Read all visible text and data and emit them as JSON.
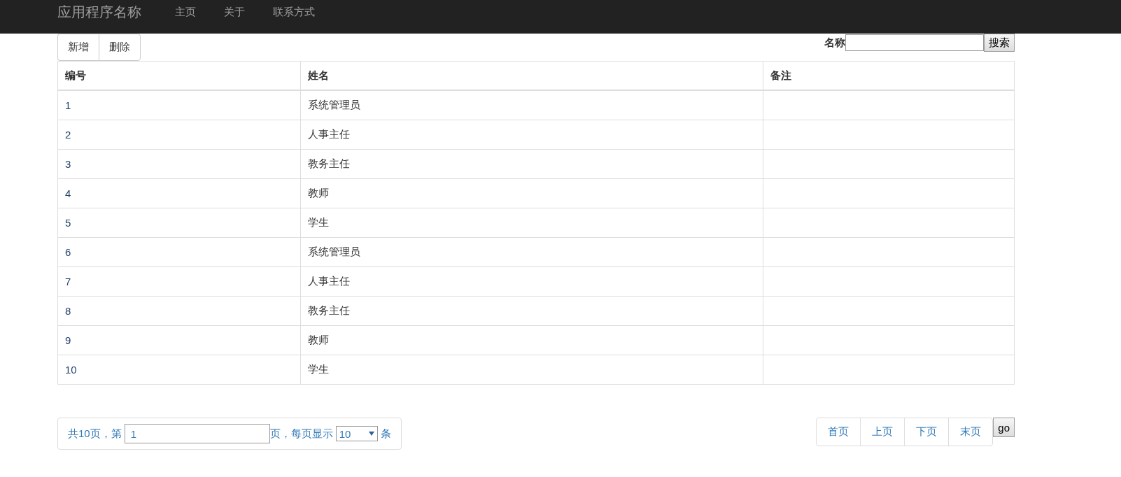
{
  "navbar": {
    "brand": "应用程序名称",
    "links": [
      {
        "label": "主页"
      },
      {
        "label": "关于"
      },
      {
        "label": "联系方式"
      }
    ]
  },
  "toolbar": {
    "buttons": [
      {
        "label": "新增"
      },
      {
        "label": "删除"
      }
    ],
    "search": {
      "label": "名称",
      "button": "搜索"
    }
  },
  "table": {
    "columns": [
      "编号",
      "姓名",
      "备注"
    ],
    "rows": [
      {
        "id": "1",
        "name": "系统管理员"
      },
      {
        "id": "2",
        "name": "人事主任"
      },
      {
        "id": "3",
        "name": "教务主任"
      },
      {
        "id": "4",
        "name": "教师"
      },
      {
        "id": "5",
        "name": "学生"
      },
      {
        "id": "6",
        "name": "系统管理员"
      },
      {
        "id": "7",
        "name": "人事主任"
      },
      {
        "id": "8",
        "name": "教务主任"
      },
      {
        "id": "9",
        "name": "教师"
      },
      {
        "id": "10",
        "name": "学生"
      }
    ]
  },
  "pagination": {
    "total_text": "共10页，第",
    "page_value": "1",
    "per_page_text": "页，每页显示",
    "page_size": "10",
    "unit": "条",
    "pager_buttons": [
      {
        "label": "首页"
      },
      {
        "label": "上页"
      },
      {
        "label": "下页"
      },
      {
        "label": "末页"
      }
    ],
    "go_button": "go"
  }
}
